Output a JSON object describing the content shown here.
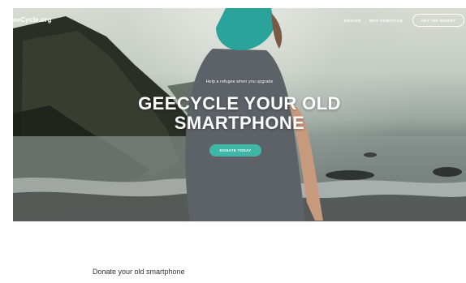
{
  "nav": {
    "logo": "eeCycle.org",
    "links": [
      "DONATE",
      "WHY GEECYCLE"
    ],
    "button": "GET THE WIDGET"
  },
  "hero": {
    "tagline": "Help a refugee when you upgrade",
    "title_line1": "GEECYCLE YOUR OLD",
    "title_line2": "SMARTPHONE",
    "cta": "DONATE TODAY"
  },
  "content": {
    "heading": "Donate your old smartphone"
  },
  "colors": {
    "accent": "#3fb7a7",
    "text_dark": "#333333"
  }
}
